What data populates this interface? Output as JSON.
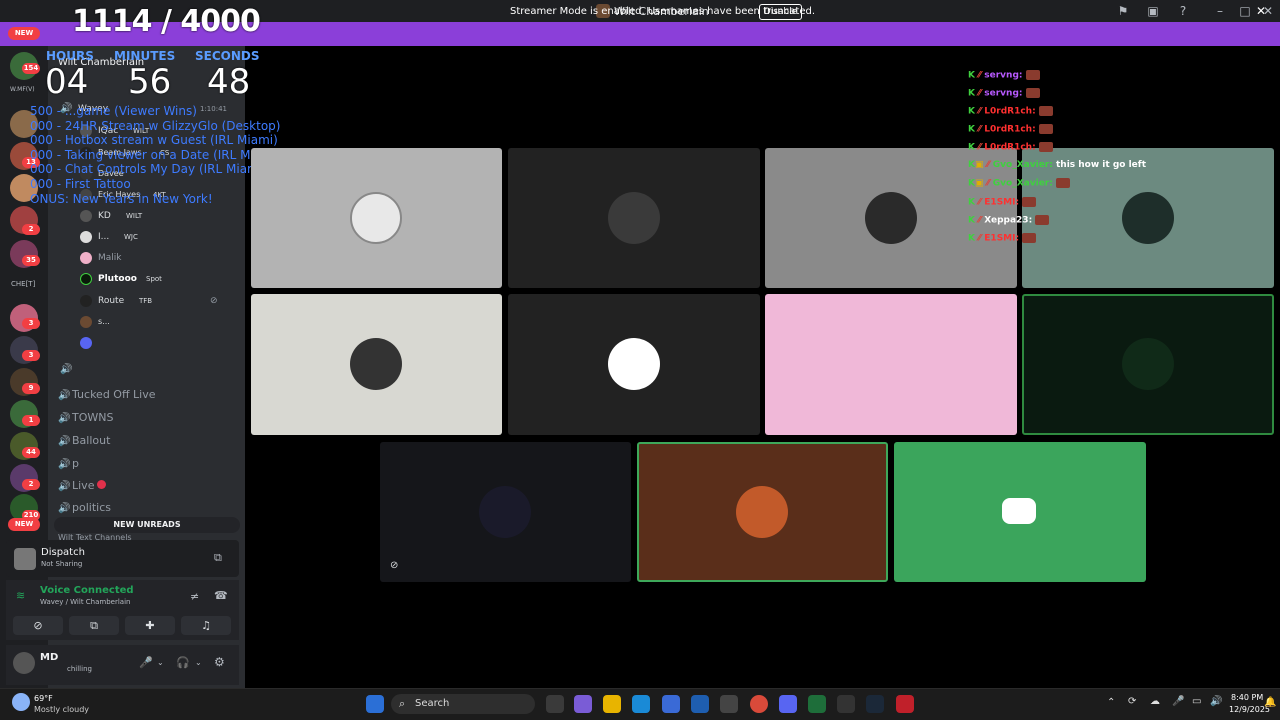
{
  "window": {
    "title": "Wilt Chamberlain"
  },
  "banner": {
    "text": "Streamer Mode is enabled. Usernames have been truncated.",
    "button": "Disable"
  },
  "overlay": {
    "counter": "1114 / 4000",
    "timer": {
      "hours_label": "HOURS",
      "minutes_label": "MINUTES",
      "seconds_label": "SECONDS",
      "hours": "04",
      "minutes": "56",
      "seconds": "48"
    },
    "schedule": [
      "500 - ...game (Viewer Wins)",
      "000 - 24HR Stream w GlizzyGlo (Desktop)",
      "000 - Hotbox stream w Guest (IRL Miami)",
      "000 - Taking viewer on a Date (IRL Miami)",
      "000 - Chat Controls My Day (IRL Miami)",
      "000 - First Tattoo",
      "ONUS: New Years in New York!"
    ]
  },
  "rail": {
    "new_top": "NEW",
    "new_bottom": "NEW",
    "badges": [
      "154",
      "13",
      "2",
      "35",
      "3",
      "3",
      "9",
      "1",
      "44",
      "2",
      "210"
    ],
    "labels": [
      "W.MF(V)",
      "CHE[T]"
    ]
  },
  "sidebar": {
    "guild": "Wilt Chamberlain",
    "voice_users": [
      {
        "name": "Wavey",
        "tag": "1:10:41"
      },
      {
        "name": "IQac",
        "tag": "WILT"
      },
      {
        "name": "Beam Jaws",
        "tag": "CS"
      },
      {
        "name": "Davee",
        "tag": ""
      },
      {
        "name": "Eric Hayes",
        "tag": "4KT"
      },
      {
        "name": "KD",
        "tag": "WILT"
      },
      {
        "name": "I...",
        "tag": "WJC"
      },
      {
        "name": "Malik",
        "tag": ""
      },
      {
        "name": "Plutooo",
        "tag": "Spot"
      },
      {
        "name": "Route",
        "tag": "TFB"
      },
      {
        "name": "s...",
        "tag": ""
      }
    ],
    "channels": [
      "Tucked Off Live",
      "TOWNS",
      "Ballout",
      "p",
      "Live",
      "politics"
    ],
    "new_unreads": "NEW UNREADS",
    "text_channels": "Wilt Text Channels"
  },
  "dispatch": {
    "title": "Dispatch",
    "status": "Not Sharing"
  },
  "voice": {
    "status": "Voice Connected",
    "location": "Wavey / Wilt Chamberlain"
  },
  "user": {
    "name": "MD",
    "status": "chilling"
  },
  "chat": [
    {
      "user": "servng:",
      "msg": ""
    },
    {
      "user": "servng:",
      "msg": ""
    },
    {
      "user": "L0rdR1ch:",
      "msg": ""
    },
    {
      "user": "L0rdR1ch:",
      "msg": ""
    },
    {
      "user": "L0rdR1ch:",
      "msg": ""
    },
    {
      "user": "Gvo_Xavier:",
      "msg": "this how it go left"
    },
    {
      "user": "Gvo_Xavier:",
      "msg": ""
    },
    {
      "user": "E1SMI:",
      "msg": ""
    },
    {
      "user": "Xeppa23:",
      "msg": ""
    },
    {
      "user": "E1SMI:",
      "msg": ""
    }
  ],
  "taskbar": {
    "weather_temp": "69°F",
    "weather_desc": "Mostly cloudy",
    "search": "Search",
    "time": "8:40 PM",
    "date": "12/9/2025"
  }
}
